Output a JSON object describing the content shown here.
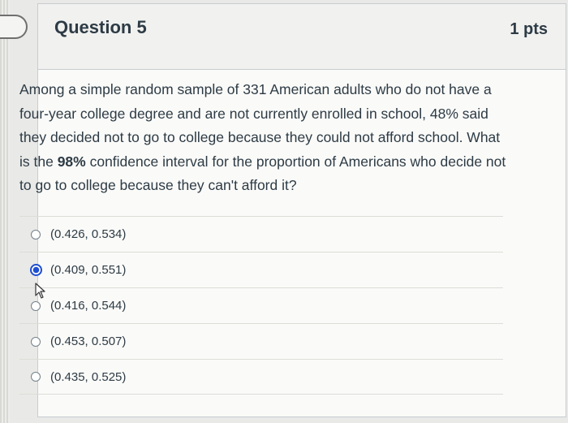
{
  "question": {
    "title": "Question 5",
    "points": "1 pts",
    "text_parts": {
      "before_bold": "Among a simple random sample of 331 American adults who do not have a four-year college degree and are not currently enrolled in school, 48% said they decided not to go to college because they could not afford school.  What is the ",
      "bold": "98%",
      "after_bold": " confidence interval for the proportion of Americans who decide not to go to college because they can't afford it?"
    }
  },
  "answers": [
    {
      "label": "(0.426, 0.534)",
      "selected": false
    },
    {
      "label": "(0.409, 0.551)",
      "selected": true
    },
    {
      "label": "(0.416, 0.544)",
      "selected": false
    },
    {
      "label": "(0.453, 0.507)",
      "selected": false
    },
    {
      "label": "(0.435, 0.525)",
      "selected": false
    }
  ],
  "colors": {
    "selected_radio": "#1f4fd1",
    "text": "#2d3b45"
  },
  "icons": {
    "bookmark": "bookmark-flag-icon",
    "cursor": "mouse-pointer-icon"
  }
}
